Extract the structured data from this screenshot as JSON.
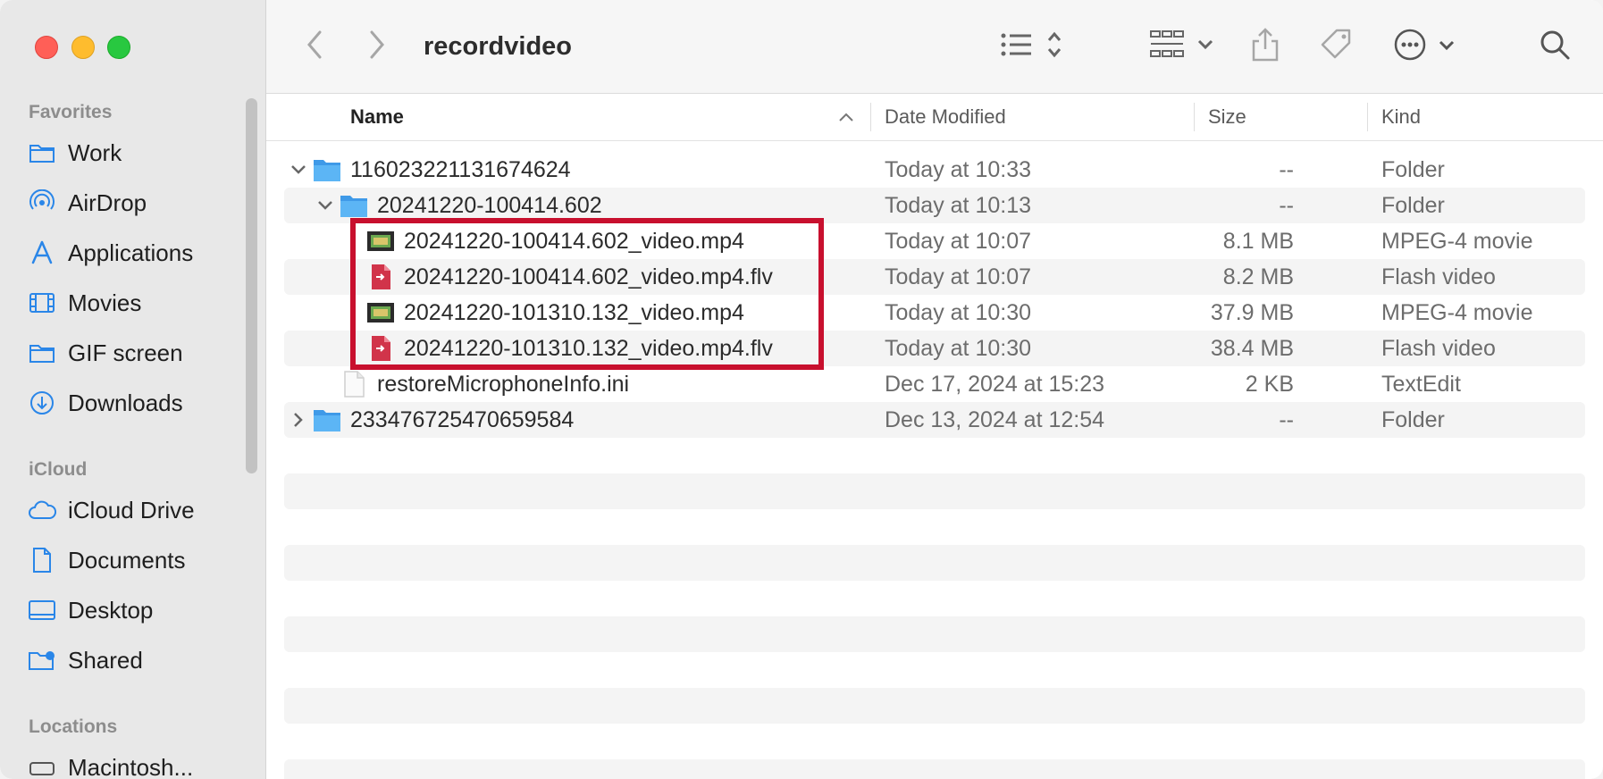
{
  "window": {
    "title": "recordvideo"
  },
  "sidebar": {
    "sections": [
      {
        "title": "Favorites",
        "items": [
          {
            "label": "Work",
            "icon": "folder-icon"
          },
          {
            "label": "AirDrop",
            "icon": "airdrop-icon"
          },
          {
            "label": "Applications",
            "icon": "applications-icon"
          },
          {
            "label": "Movies",
            "icon": "film-icon"
          },
          {
            "label": "GIF screen",
            "icon": "folder-icon"
          },
          {
            "label": "Downloads",
            "icon": "download-icon"
          }
        ]
      },
      {
        "title": "iCloud",
        "items": [
          {
            "label": "iCloud Drive",
            "icon": "cloud-icon"
          },
          {
            "label": "Documents",
            "icon": "document-icon"
          },
          {
            "label": "Desktop",
            "icon": "desktop-icon"
          },
          {
            "label": "Shared",
            "icon": "shared-folder-icon"
          }
        ]
      },
      {
        "title": "Locations",
        "items": [
          {
            "label": "Macintosh...",
            "icon": "disk-icon"
          }
        ]
      }
    ]
  },
  "columns": {
    "name": "Name",
    "date": "Date Modified",
    "size": "Size",
    "kind": "Kind"
  },
  "files": [
    {
      "name": "116023221131674624",
      "date": "Today at 10:33",
      "size": "--",
      "kind": "Folder",
      "type": "folder",
      "disclosure": "expanded"
    },
    {
      "name": "20241220-100414.602",
      "date": "Today at 10:13",
      "size": "--",
      "kind": "Folder",
      "type": "folder",
      "disclosure": "expanded"
    },
    {
      "name": "20241220-100414.602_video.mp4",
      "date": "Today at 10:07",
      "size": "8.1 MB",
      "kind": "MPEG-4 movie",
      "type": "mp4"
    },
    {
      "name": "20241220-100414.602_video.mp4.flv",
      "date": "Today at 10:07",
      "size": "8.2 MB",
      "kind": "Flash video",
      "type": "flv"
    },
    {
      "name": "20241220-101310.132_video.mp4",
      "date": "Today at 10:30",
      "size": "37.9 MB",
      "kind": "MPEG-4 movie",
      "type": "mp4"
    },
    {
      "name": "20241220-101310.132_video.mp4.flv",
      "date": "Today at 10:30",
      "size": "38.4 MB",
      "kind": "Flash video",
      "type": "flv"
    },
    {
      "name": "restoreMicrophoneInfo.ini",
      "date": "Dec 17, 2024 at 15:23",
      "size": "2 KB",
      "kind": "TextEdit",
      "type": "text"
    },
    {
      "name": "233476725470659584",
      "date": "Dec 13, 2024 at 12:54",
      "size": "--",
      "kind": "Folder",
      "type": "folder",
      "disclosure": "collapsed"
    }
  ],
  "colors": {
    "highlight": "#c8102e",
    "folder": "#4aa8ef",
    "accent": "#007aff"
  }
}
